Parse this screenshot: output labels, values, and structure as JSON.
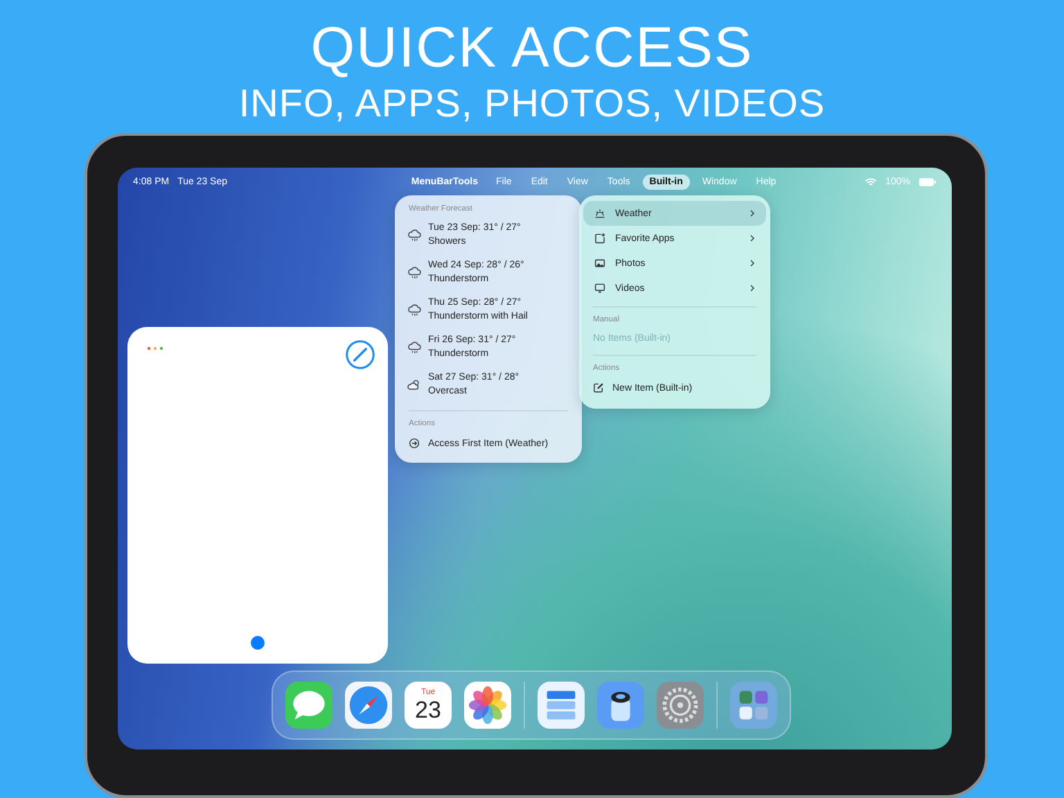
{
  "headline": {
    "title": "QUICK ACCESS",
    "subtitle": "INFO, APPS, PHOTOS, VIDEOS"
  },
  "menu_bar": {
    "time": "4:08 PM",
    "date": "Tue 23 Sep",
    "app_name": "MenuBarTools",
    "menus": [
      {
        "label": "File",
        "selected": false
      },
      {
        "label": "Edit",
        "selected": false
      },
      {
        "label": "View",
        "selected": false
      },
      {
        "label": "Tools",
        "selected": false
      },
      {
        "label": "Built-in",
        "selected": true
      },
      {
        "label": "Window",
        "selected": false
      },
      {
        "label": "Help",
        "selected": false
      }
    ],
    "battery": "100%"
  },
  "weather_menu": {
    "heading": "Weather Forecast",
    "items": [
      {
        "line1": "Tue 23 Sep: 31° / 27°",
        "line2": "Showers"
      },
      {
        "line1": "Wed 24 Sep: 28° / 26°",
        "line2": "Thunderstorm"
      },
      {
        "line1": "Thu 25 Sep: 28° / 27°",
        "line2": "Thunderstorm with Hail"
      },
      {
        "line1": "Fri 26 Sep: 31° / 27°",
        "line2": "Thunderstorm"
      },
      {
        "line1": "Sat 27 Sep: 31° / 28°",
        "line2": "Overcast"
      }
    ],
    "actions_heading": "Actions",
    "actions": [
      {
        "label": "Access First Item (Weather)"
      }
    ]
  },
  "builtin_menu": {
    "items": [
      {
        "label": "Weather",
        "selected": true
      },
      {
        "label": "Favorite Apps",
        "selected": false
      },
      {
        "label": "Photos",
        "selected": false
      },
      {
        "label": "Videos",
        "selected": false
      }
    ],
    "manual_heading": "Manual",
    "manual_items": [
      {
        "label": "No Items (Built-in)",
        "disabled": true
      }
    ],
    "actions_heading": "Actions",
    "actions": [
      {
        "label": "New Item (Built-in)"
      }
    ]
  },
  "dock": {
    "calendar_day": "Tue",
    "calendar_date": "23"
  }
}
